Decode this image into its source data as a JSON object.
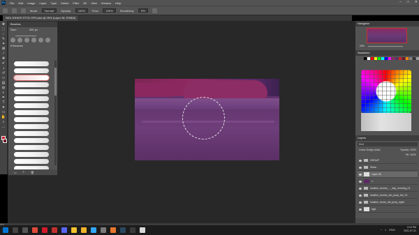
{
  "menubar": {
    "items": [
      "File",
      "Edit",
      "Image",
      "Layer",
      "Type",
      "Select",
      "Filter",
      "3D",
      "View",
      "Window",
      "Help"
    ],
    "window_controls": [
      "–",
      "□",
      "✕"
    ]
  },
  "options": {
    "mode_label": "Mode:",
    "mode_value": "Normal",
    "opacity_label": "Opacity:",
    "opacity_value": "100%",
    "flow_label": "Flow:",
    "flow_value": "100%",
    "smoothing_label": "Smoothing:",
    "smoothing_value": "0%"
  },
  "document": {
    "tab_label": "SEA JOHN'S STTIC EP9 phd @ 25% (Layer 36, RGB/8)"
  },
  "brushes_panel": {
    "title": "Brushes",
    "size_label": "Size:",
    "size_value": "300 px",
    "group_label": "Brushes",
    "stroke_count": 16,
    "selected_index": 2
  },
  "navigator": {
    "title": "Navigator",
    "zoom": "25%"
  },
  "swatches": {
    "title": "Swatches",
    "top_row_colors": [
      "#000000",
      "#ffffff",
      "#ff0000",
      "#ffff00",
      "#00ff00",
      "#00ffff",
      "#0000ff",
      "#ff00ff",
      "#8a2b62",
      "#5c2f66",
      "#cc1b2b",
      "#6b1a2a",
      "#ff8800",
      "#888888",
      "#333333",
      "#a0a0a0"
    ]
  },
  "layers": {
    "title": "Layers",
    "filter_label": "Kind",
    "blend_mode": "Linear Dodge (Add)",
    "opacity_label": "Opacity:",
    "opacity_value": "100%",
    "fill_label": "Fill:",
    "fill_value": "100%",
    "items": [
      {
        "name": "GROUP",
        "type": "folder",
        "selected": false
      },
      {
        "name": "Shine",
        "type": "folder",
        "selected": false
      },
      {
        "name": "Layer 36",
        "type": "layer",
        "selected": true
      },
      {
        "name": "1",
        "type": "layer",
        "selected": false
      },
      {
        "name": "location_homes_..._day_morning_01",
        "type": "folder",
        "selected": false
      },
      {
        "name": "location_homes_oth_jump_the_01",
        "type": "folder",
        "selected": false
      },
      {
        "name": "location_home_oth_jump_night",
        "type": "folder",
        "selected": false
      },
      {
        "name": "bgA",
        "type": "layer",
        "selected": false
      }
    ]
  },
  "status": {
    "zoom": "25%"
  },
  "taskbar": {
    "icons": [
      {
        "name": "start",
        "color": "#0078d7"
      },
      {
        "name": "search",
        "color": "#444444"
      },
      {
        "name": "task-view",
        "color": "#555555"
      },
      {
        "name": "chrome",
        "color": "#e04a3a"
      },
      {
        "name": "opera",
        "color": "#d01a2a"
      },
      {
        "name": "app-red",
        "color": "#c0302f"
      },
      {
        "name": "discord",
        "color": "#5865f2"
      },
      {
        "name": "app-yellow",
        "color": "#f2c12e"
      },
      {
        "name": "file-explorer",
        "color": "#f0b429"
      },
      {
        "name": "photoshop",
        "color": "#31a8ff"
      },
      {
        "name": "app-gray",
        "color": "#7a7a7a"
      },
      {
        "name": "app-orange",
        "color": "#e8772e"
      },
      {
        "name": "steam",
        "color": "#2a475e"
      },
      {
        "name": "app-dark",
        "color": "#3a3a3a"
      },
      {
        "name": "app-white",
        "color": "#d8d8d8"
      }
    ],
    "time": "2:10 PM",
    "date": "2021-07-21",
    "lang": "ENG"
  }
}
